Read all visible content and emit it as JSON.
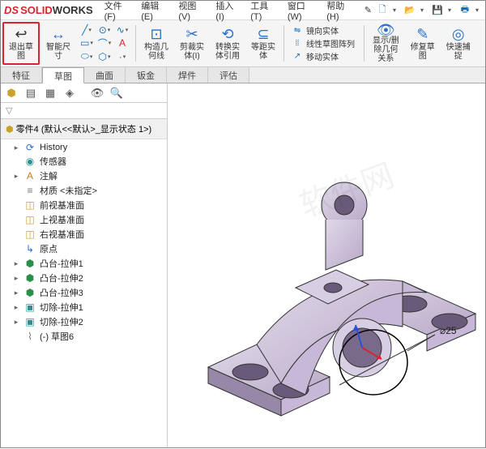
{
  "logo": {
    "ds": "DS",
    "brand_a": "SOLID",
    "brand_b": "WORKS"
  },
  "menus": [
    "文件(F)",
    "编辑(E)",
    "视图(V)",
    "插入(I)",
    "工具(T)",
    "窗口(W)",
    "帮助(H)",
    "✎"
  ],
  "ribbon": {
    "exit_sketch": "退出草\n图",
    "smart_dim": "智能尺\n寸",
    "offset_entities": "构造几\n何线",
    "trim": "剪裁实\n体(I)",
    "convert": "转换实\n体引用",
    "isometric": "等距实\n体",
    "mirror": "镜向实体",
    "linear_pattern": "线性草图阵列",
    "move": "移动实体",
    "hide_show": "显示/删\n除几何\n关系",
    "repair": "修复草\n图",
    "quick_snap": "快速捕\n捉"
  },
  "tabs": [
    "特征",
    "草图",
    "曲面",
    "钣金",
    "焊件",
    "评估"
  ],
  "active_tab": 1,
  "panel_title": "零件4 (默认<<默认>_显示状态 1>)",
  "tree": [
    {
      "depth": 1,
      "twist": "▸",
      "icon": "⟳",
      "cls": "c-blue",
      "label": "History"
    },
    {
      "depth": 1,
      "twist": "",
      "icon": "◉",
      "cls": "c-teal",
      "label": "传感器"
    },
    {
      "depth": 1,
      "twist": "▸",
      "icon": "A",
      "cls": "c-orange",
      "label": "注解"
    },
    {
      "depth": 1,
      "twist": "",
      "icon": "≡",
      "cls": "c-grey",
      "label": "材质 <未指定>"
    },
    {
      "depth": 1,
      "twist": "",
      "icon": "◫",
      "cls": "c-gold",
      "label": "前视基准面"
    },
    {
      "depth": 1,
      "twist": "",
      "icon": "◫",
      "cls": "c-gold",
      "label": "上视基准面"
    },
    {
      "depth": 1,
      "twist": "",
      "icon": "◫",
      "cls": "c-gold",
      "label": "右视基准面"
    },
    {
      "depth": 1,
      "twist": "",
      "icon": "↳",
      "cls": "c-blue",
      "label": "原点"
    },
    {
      "depth": 1,
      "twist": "▸",
      "icon": "⬢",
      "cls": "c-green",
      "label": "凸台-拉伸1"
    },
    {
      "depth": 1,
      "twist": "▸",
      "icon": "⬢",
      "cls": "c-green",
      "label": "凸台-拉伸2"
    },
    {
      "depth": 1,
      "twist": "▸",
      "icon": "⬢",
      "cls": "c-green",
      "label": "凸台-拉伸3"
    },
    {
      "depth": 1,
      "twist": "▸",
      "icon": "▣",
      "cls": "c-teal",
      "label": "切除-拉伸1"
    },
    {
      "depth": 1,
      "twist": "▸",
      "icon": "▣",
      "cls": "c-teal",
      "label": "切除-拉伸2"
    },
    {
      "depth": 1,
      "twist": "",
      "icon": "⌇",
      "cls": "c-grey",
      "label": "(-) 草图6"
    }
  ],
  "dimension": "⌀25"
}
